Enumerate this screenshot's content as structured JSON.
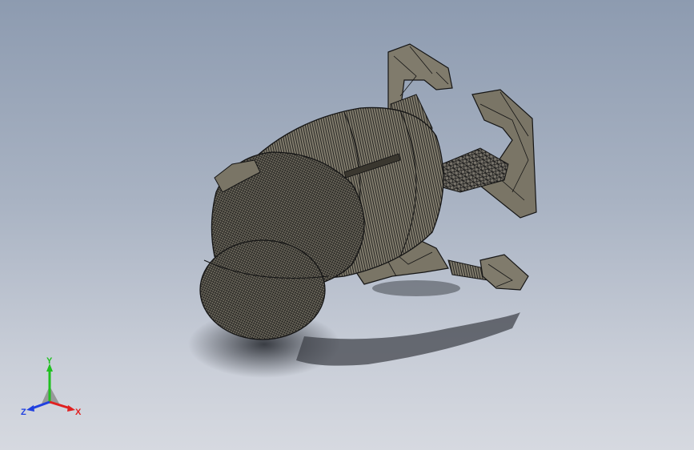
{
  "viewport": {
    "background_top": "#8d9bb0",
    "background_bottom": "#d6d9e0",
    "model_color": "#6e6a5c",
    "wire_color": "#111111"
  },
  "triad": {
    "x_label": "X",
    "y_label": "Y",
    "z_label": "Z",
    "x_color": "#e02020",
    "y_color": "#20c020",
    "z_color": "#2040e0"
  }
}
